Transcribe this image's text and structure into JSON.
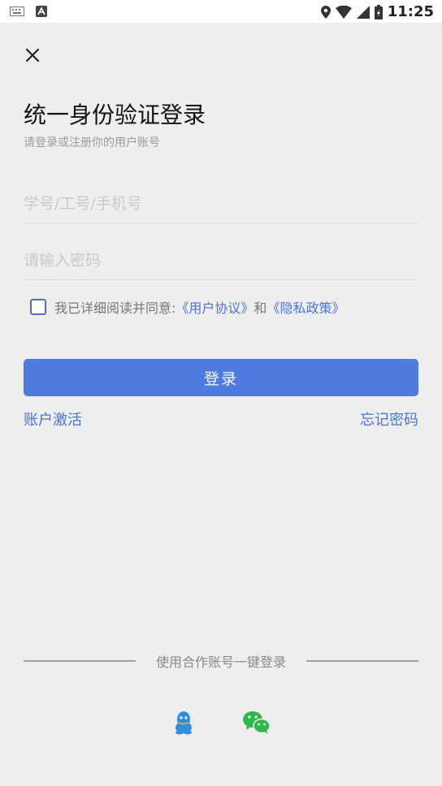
{
  "status_bar": {
    "time": "11:25"
  },
  "header": {
    "title": "统一身份验证登录",
    "subtitle": "请登录或注册你的用户账号"
  },
  "form": {
    "username_placeholder": "学号/工号/手机号",
    "password_placeholder": "请输入密码",
    "agree_prefix": "我已详细阅读并同意:",
    "user_agreement": "《用户协议》",
    "and": "和",
    "privacy_policy": "《隐私政策》",
    "agree_checked": false
  },
  "buttons": {
    "login": "登录",
    "activate": "账户激活",
    "forgot": "忘记密码"
  },
  "third_party": {
    "label": "使用合作账号一键登录",
    "items": [
      "qq-icon",
      "wechat-icon"
    ]
  },
  "colors": {
    "accent": "#4f7be0",
    "link": "#4a74db",
    "qq": "#2b8fe8",
    "wechat": "#2db84b"
  }
}
